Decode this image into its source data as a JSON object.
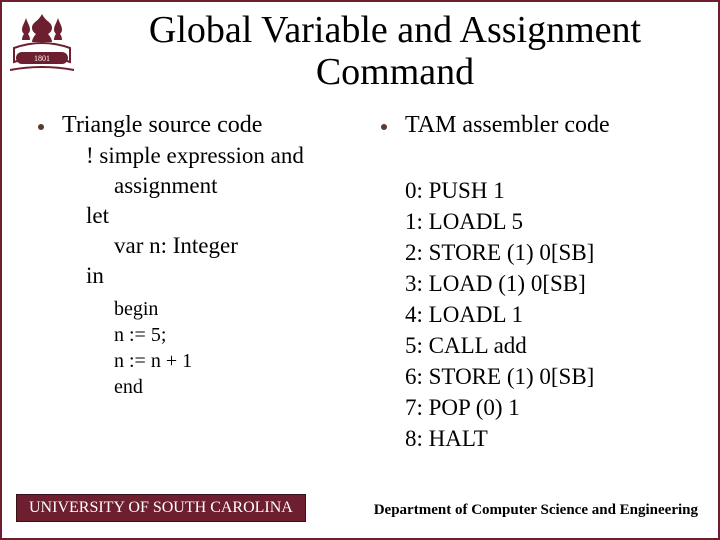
{
  "title": "Global Variable and Assignment Command",
  "left": {
    "heading": "Triangle source code",
    "lines": {
      "l1": "! simple expression and",
      "l2": "assignment",
      "l3": "let",
      "l4": "var n: Integer",
      "l5": "in"
    },
    "code": {
      "c1": "begin",
      "c2": "n := 5;",
      "c3": "n := n + 1",
      "c4": "end"
    }
  },
  "right": {
    "heading": "TAM assembler code",
    "lines": {
      "t0": "0: PUSH 1",
      "t1": "1: LOADL 5",
      "t2": "2: STORE (1) 0[SB]",
      "t3": "3: LOAD (1) 0[SB]",
      "t4": "4: LOADL 1",
      "t5": "5: CALL add",
      "t6": "6: STORE (1) 0[SB]",
      "t7": "7: POP (0) 1",
      "t8": "8: HALT"
    }
  },
  "footer": {
    "left": "UNIVERSITY OF SOUTH CAROLINA",
    "right": "Department of Computer Science and Engineering"
  }
}
